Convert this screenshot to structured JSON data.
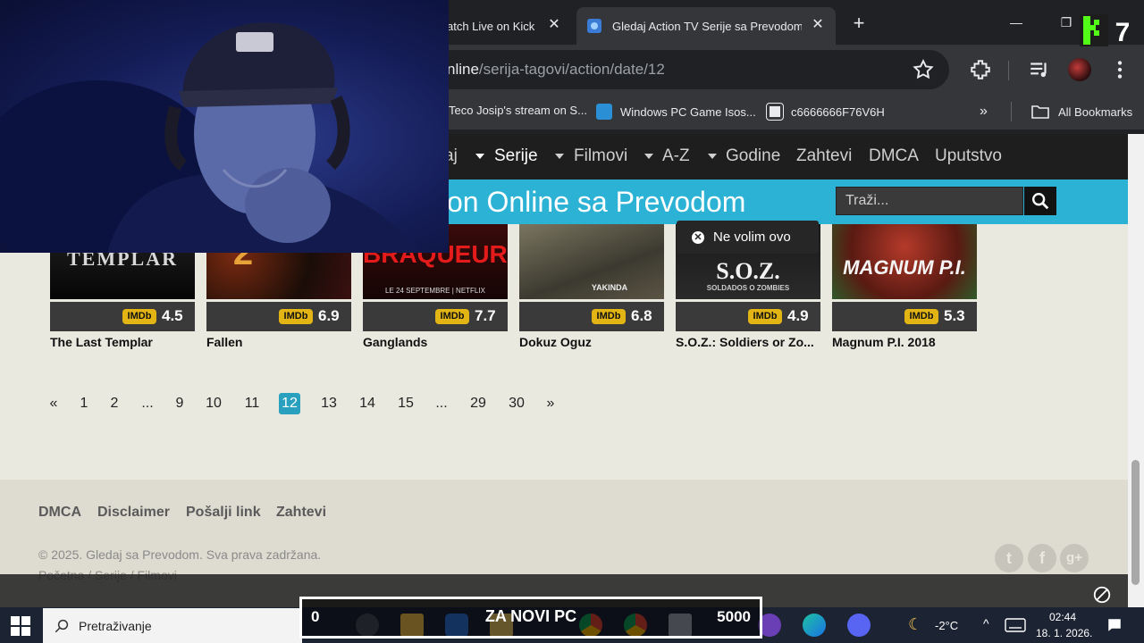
{
  "browser": {
    "tabs": [
      {
        "title": "atch Live on Kick",
        "active": false
      },
      {
        "title": "Gledaj Action TV Serije sa Prevodom O",
        "active": true
      }
    ],
    "url_host": "nline",
    "url_path": "/serija-tagovi/action/date/12",
    "bookmarks": [
      "Teco Josip's stream on S...",
      "Windows PC Game Isos...",
      "c6666666F76V6H"
    ],
    "all_bookmarks": "All Bookmarks"
  },
  "site": {
    "nav": [
      {
        "label": "aj",
        "has_caret": false,
        "active": false
      },
      {
        "label": "Serije",
        "has_caret": true,
        "active": true
      },
      {
        "label": "Filmovi",
        "has_caret": true,
        "active": false
      },
      {
        "label": "A-Z",
        "has_caret": true,
        "active": false
      },
      {
        "label": "Godine",
        "has_caret": true,
        "active": false
      },
      {
        "label": "Zahtevi",
        "has_caret": false,
        "active": false
      },
      {
        "label": "DMCA",
        "has_caret": false,
        "active": false
      },
      {
        "label": "Uputstvo",
        "has_caret": false,
        "active": false
      }
    ],
    "banner_title": "on Online sa Prevodom",
    "search_placeholder": "Traži...",
    "cards": [
      {
        "title": "The Last Templar",
        "rating": "4.5",
        "poster_text": "TEMPLAR",
        "sub_text": "",
        "imdb": "IMDb"
      },
      {
        "title": "Fallen",
        "rating": "6.9",
        "poster_text": "2",
        "sub_text": "",
        "imdb": "IMDb"
      },
      {
        "title": "Ganglands",
        "rating": "7.7",
        "poster_text": "BRAQUEURS",
        "sub_text": "LE 24 SEPTEMBRE | NETFLIX",
        "imdb": "IMDb"
      },
      {
        "title": "Dokuz Oguz",
        "rating": "6.8",
        "poster_text": "",
        "sub_text": "YAKINDA",
        "imdb": "IMDb"
      },
      {
        "title": "S.O.Z.: Soldiers or Zo...",
        "rating": "4.9",
        "poster_text": "S.O.Z.",
        "sub_text": "SOLDADOS O ZOMBIES",
        "imdb": "IMDb"
      },
      {
        "title": "Magnum P.I. 2018",
        "rating": "5.3",
        "poster_text": "MAGNUM P.I.",
        "sub_text": "",
        "imdb": "IMDb"
      }
    ],
    "dislike_label": "Ne volim ovo",
    "pagination": [
      {
        "label": "«",
        "active": false
      },
      {
        "label": "1",
        "active": false
      },
      {
        "label": "2",
        "active": false
      },
      {
        "label": "...",
        "active": false
      },
      {
        "label": "9",
        "active": false
      },
      {
        "label": "10",
        "active": false
      },
      {
        "label": "11",
        "active": false
      },
      {
        "label": "12",
        "active": true
      },
      {
        "label": "13",
        "active": false
      },
      {
        "label": "14",
        "active": false
      },
      {
        "label": "15",
        "active": false
      },
      {
        "label": "...",
        "active": false
      },
      {
        "label": "29",
        "active": false
      },
      {
        "label": "30",
        "active": false
      },
      {
        "label": "»",
        "active": false
      }
    ],
    "footer": {
      "links": [
        "DMCA",
        "Disclaimer",
        "Pošalji link",
        "Zahtevi"
      ],
      "copyright": "© 2025. Gledaj sa Prevodom. Sva prava zadržana.",
      "breadcrumbs": "Početna / Serije / Filmovi",
      "social": [
        "twitter-icon",
        "facebook-icon",
        "google-plus-icon"
      ]
    }
  },
  "overlay": {
    "goal_left": "0",
    "goal_title": "ZA NOVI PC",
    "goal_right": "5000",
    "kick_badge": "7"
  },
  "taskbar": {
    "search_placeholder": "Pretraživanje",
    "weather": "-2°C",
    "time": "02:44",
    "date": "18. 1. 2026."
  },
  "colors": {
    "accent": "#2cb2d5",
    "active_page": "#2aa0bf",
    "imdb": "#e3b514",
    "nav_bg": "#1e1e1e",
    "page_bg": "#eae9df"
  }
}
